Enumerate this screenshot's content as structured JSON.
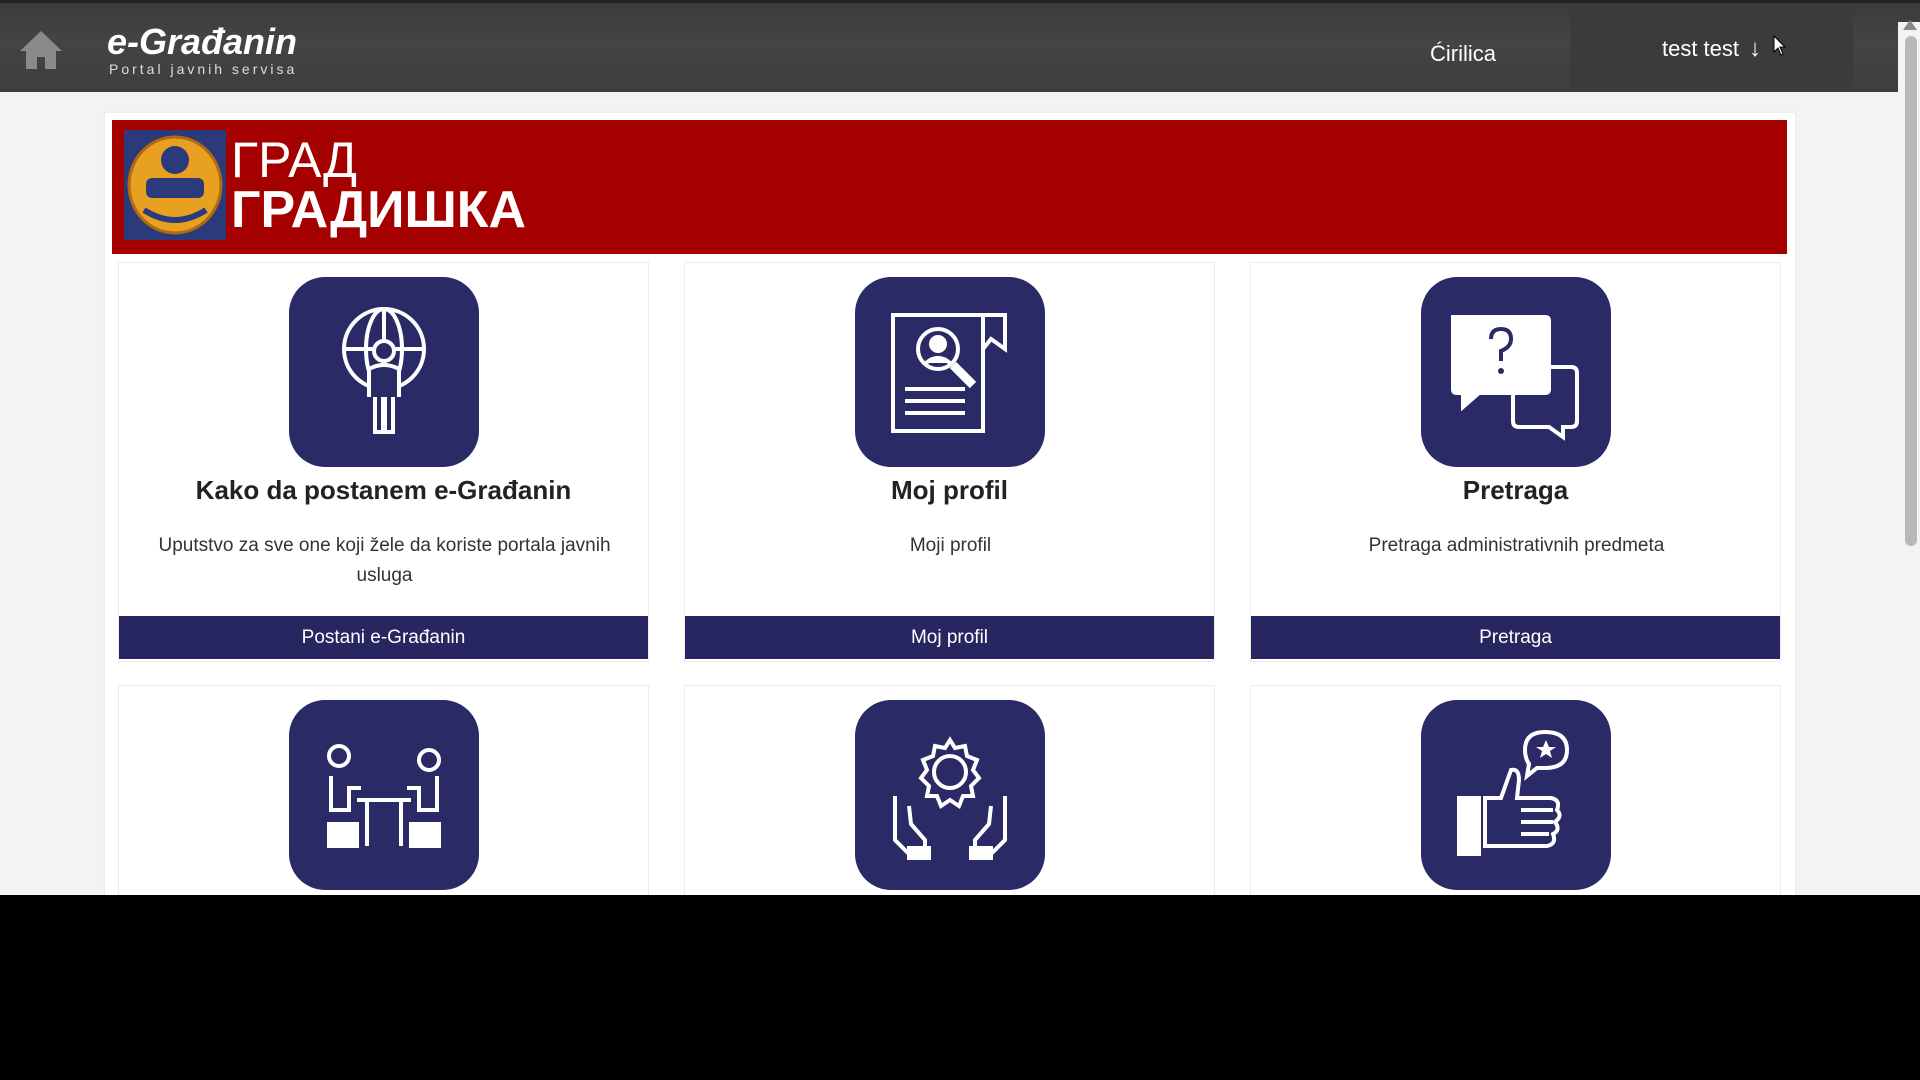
{
  "header": {
    "brand_title": "e-Građanin",
    "brand_subtitle": "Portal javnih servisa",
    "language_link": "Ćirilica",
    "user_name": "test test",
    "user_arrow": "↓"
  },
  "banner": {
    "line1": "ГРАД",
    "line2": "ГРАДИШКА"
  },
  "cards": [
    {
      "title": "Kako da postanem e-Građanin",
      "description": "Uputstvo za sve one koji žele da koriste portala javnih usluga",
      "button": "Postani e-Građanin",
      "icon": "globe-person-icon"
    },
    {
      "title": "Moj profil",
      "description": "Moji profil",
      "button": "Moj profil",
      "icon": "profile-search-document-icon"
    },
    {
      "title": "Pretraga",
      "description": "Pretraga administrativnih predmeta",
      "button": "Pretraga",
      "icon": "question-chat-icon"
    },
    {
      "icon": "meeting-table-icon"
    },
    {
      "icon": "hands-gear-icon"
    },
    {
      "icon": "thumbs-up-review-icon"
    }
  ],
  "colors": {
    "topbar": "#3e3e3e",
    "banner": "#a50000",
    "tile": "#2a2a66",
    "button": "#272660"
  }
}
